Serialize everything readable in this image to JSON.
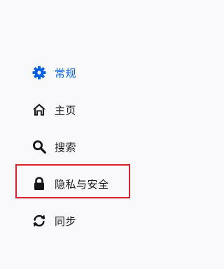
{
  "sidebar": {
    "items": [
      {
        "label": "常规",
        "icon": "gear-icon",
        "selected": true
      },
      {
        "label": "主页",
        "icon": "home-icon",
        "selected": false
      },
      {
        "label": "搜索",
        "icon": "search-icon",
        "selected": false
      },
      {
        "label": "隐私与安全",
        "icon": "lock-icon",
        "selected": false,
        "highlighted": true
      },
      {
        "label": "同步",
        "icon": "sync-icon",
        "selected": false
      }
    ]
  },
  "colors": {
    "background": "#f9f9fb",
    "selected": "#0060df",
    "text": "#15141a",
    "highlight_border": "#d7212f"
  }
}
